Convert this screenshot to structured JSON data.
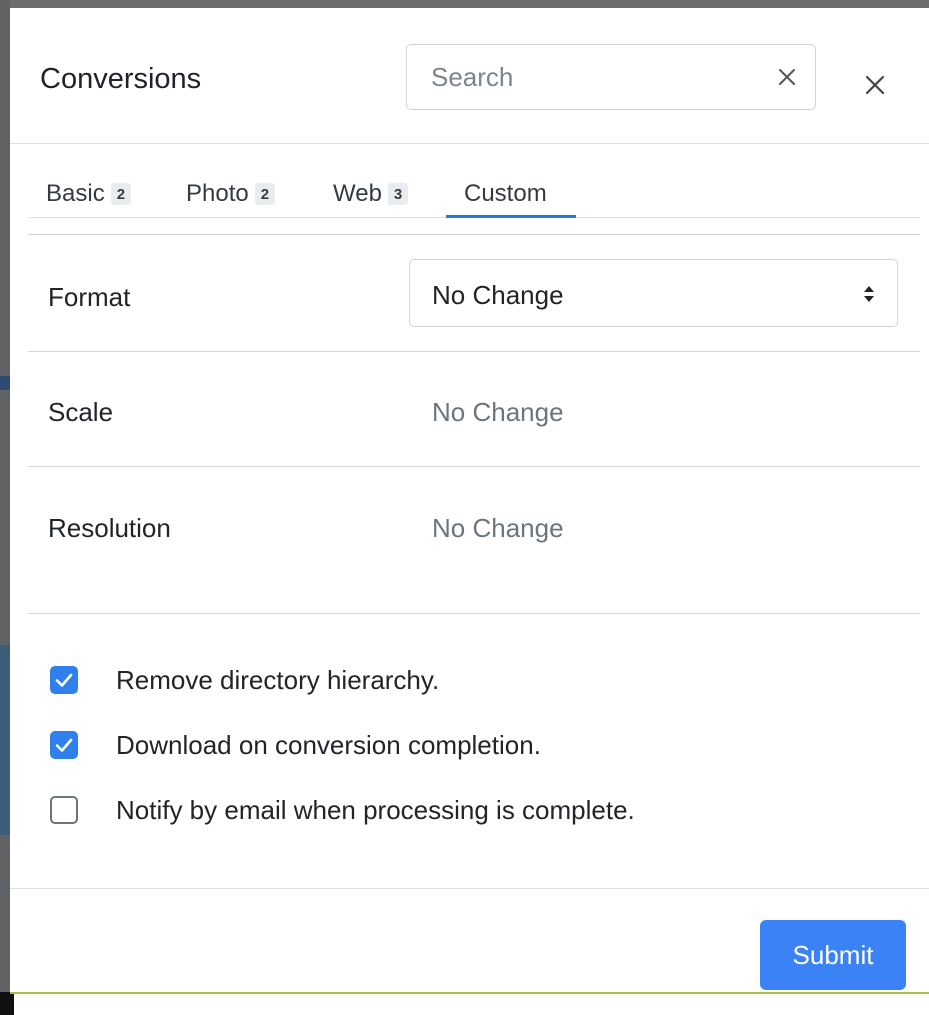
{
  "modal": {
    "title": "Conversions",
    "search": {
      "placeholder": "Search",
      "value": ""
    }
  },
  "tabs": [
    {
      "label": "Basic",
      "count": "2"
    },
    {
      "label": "Photo",
      "count": "2"
    },
    {
      "label": "Web",
      "count": "3"
    },
    {
      "label": "Custom",
      "active": true
    }
  ],
  "settings": {
    "format": {
      "label": "Format",
      "value": "No Change"
    },
    "scale": {
      "label": "Scale",
      "value": "No Change"
    },
    "resolution": {
      "label": "Resolution",
      "value": "No Change"
    }
  },
  "options": [
    {
      "label": "Remove directory hierarchy.",
      "checked": true
    },
    {
      "label": "Download on conversion completion.",
      "checked": true
    },
    {
      "label": "Notify by email when processing is complete.",
      "checked": false
    }
  ],
  "footer": {
    "submit_label": "Submit"
  },
  "colors": {
    "accent": "#3b82f6",
    "checkbox_checked": "#2f80ed",
    "tab_underline": "#1f7fe0"
  },
  "icons": {
    "search_clear": "close-icon",
    "modal_close": "close-icon",
    "select": "sort-arrows-icon",
    "checkmark": "check-icon"
  }
}
